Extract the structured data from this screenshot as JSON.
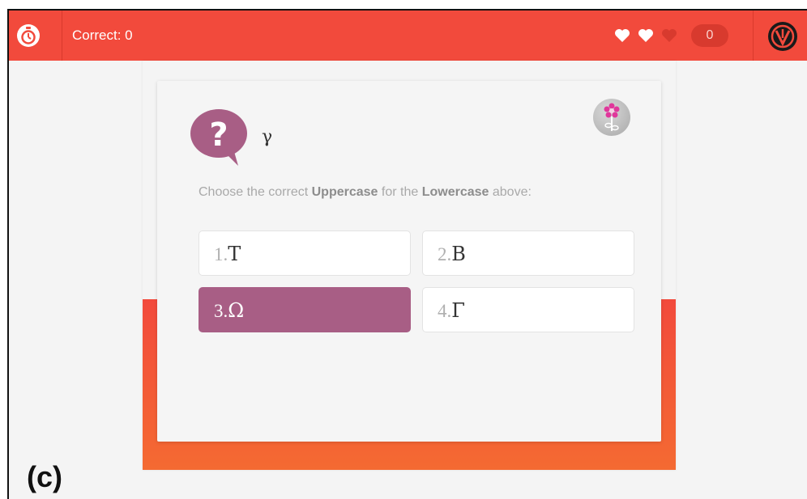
{
  "header": {
    "correct_label": "Correct: 0",
    "score": "0",
    "lives_full": 2,
    "lives_total": 3
  },
  "question": {
    "prompt_letter": "γ",
    "instruction_pre": "Choose the correct ",
    "instruction_bold1": "Uppercase",
    "instruction_mid": " for the ",
    "instruction_bold2": "Lowercase",
    "instruction_post": " above:"
  },
  "options": [
    {
      "num": "1.",
      "letter": "Τ"
    },
    {
      "num": "2.",
      "letter": "Β"
    },
    {
      "num": "3.",
      "letter": "Ω",
      "selected": true
    },
    {
      "num": "4.",
      "letter": "Γ"
    }
  ],
  "caption": "(c)",
  "colors": {
    "topbar": "#f24a3c",
    "selected_option": "#a85e85",
    "question_bubble": "#a85e85",
    "accent_orange": "#f46a32"
  },
  "icons": {
    "timer": "stopwatch-icon",
    "heart": "heart-icon",
    "logo": "brand-logo-icon",
    "question": "question-bubble-icon",
    "flower": "flower-icon"
  }
}
